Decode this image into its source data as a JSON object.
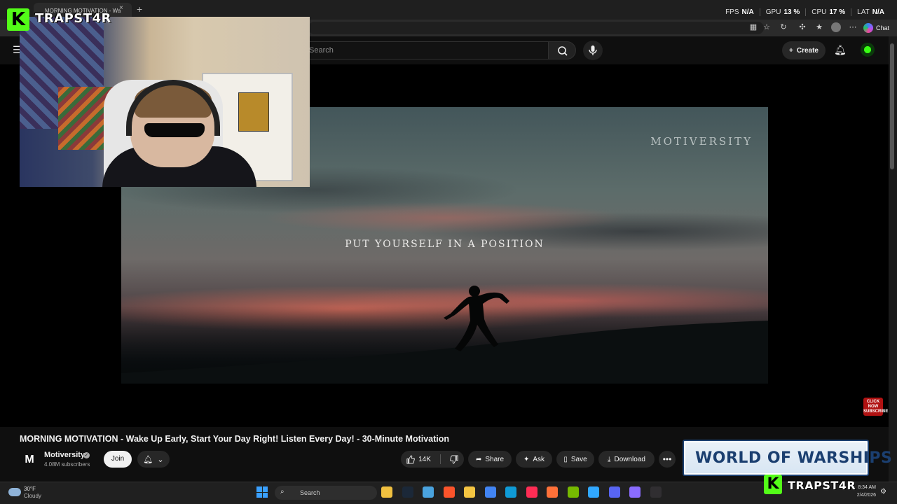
{
  "browser": {
    "tab_title": "MORNING MOTIVATION - Wa",
    "tab_close": "×",
    "new_tab": "+",
    "chat_label": "Chat"
  },
  "perf": [
    {
      "label": "FPS",
      "value": "N/A"
    },
    {
      "label": "GPU",
      "value": "13 %"
    },
    {
      "label": "CPU",
      "value": "17 %"
    },
    {
      "label": "LAT",
      "value": "N/A"
    }
  ],
  "youtube": {
    "search_placeholder": "Search",
    "create_label": "Create"
  },
  "stream": {
    "name": "TRAPST4R",
    "k_glyph": "K"
  },
  "video": {
    "brand": "MOTIVERSITY",
    "caption": "PUT YOURSELF IN A POSITION",
    "click_now": "CLICK NOW SUBSCRIBE",
    "title": "MORNING MOTIVATION - Wake Up Early, Start Your Day Right! Listen Every Day! - 30-Minute Motivation"
  },
  "channel": {
    "logo_letter": "M",
    "name": "Motiversity",
    "subscribers": "4.08M subscribers",
    "join_label": "Join"
  },
  "actions": {
    "likes": "14K",
    "share": "Share",
    "ask": "Ask",
    "save": "Save",
    "download": "Download",
    "more": "•••"
  },
  "ad": {
    "text": "WORLD OF WARSHIPS"
  },
  "taskbar": {
    "temperature": "30°F",
    "condition": "Cloudy",
    "search_label": "Search",
    "time": "8:34 AM",
    "date": "2/4/2026",
    "apps": [
      {
        "name": "file-explorer-icon",
        "color": "#f0c040"
      },
      {
        "name": "steam-icon",
        "color": "#1b2838"
      },
      {
        "name": "notepad-icon",
        "color": "#4aa3df"
      },
      {
        "name": "brave-icon",
        "color": "#fb542b"
      },
      {
        "name": "folder-icon",
        "color": "#f5c542"
      },
      {
        "name": "chrome-icon",
        "color": "#4285f4"
      },
      {
        "name": "edge-icon",
        "color": "#0f9bd7"
      },
      {
        "name": "capcut-icon",
        "color": "#ff2d55"
      },
      {
        "name": "firefox-icon",
        "color": "#ff7139"
      },
      {
        "name": "nvidia-icon",
        "color": "#76b900"
      },
      {
        "name": "photoshop-icon",
        "color": "#31a8ff"
      },
      {
        "name": "discord-icon",
        "color": "#5865f2"
      },
      {
        "name": "app-grid-icon",
        "color": "#8a6cff"
      },
      {
        "name": "obs-icon",
        "color": "#302e31"
      }
    ]
  },
  "colors": {
    "kick_green": "#53fc18",
    "yt_bg": "#0f0f0f",
    "pill_bg": "#272727"
  }
}
